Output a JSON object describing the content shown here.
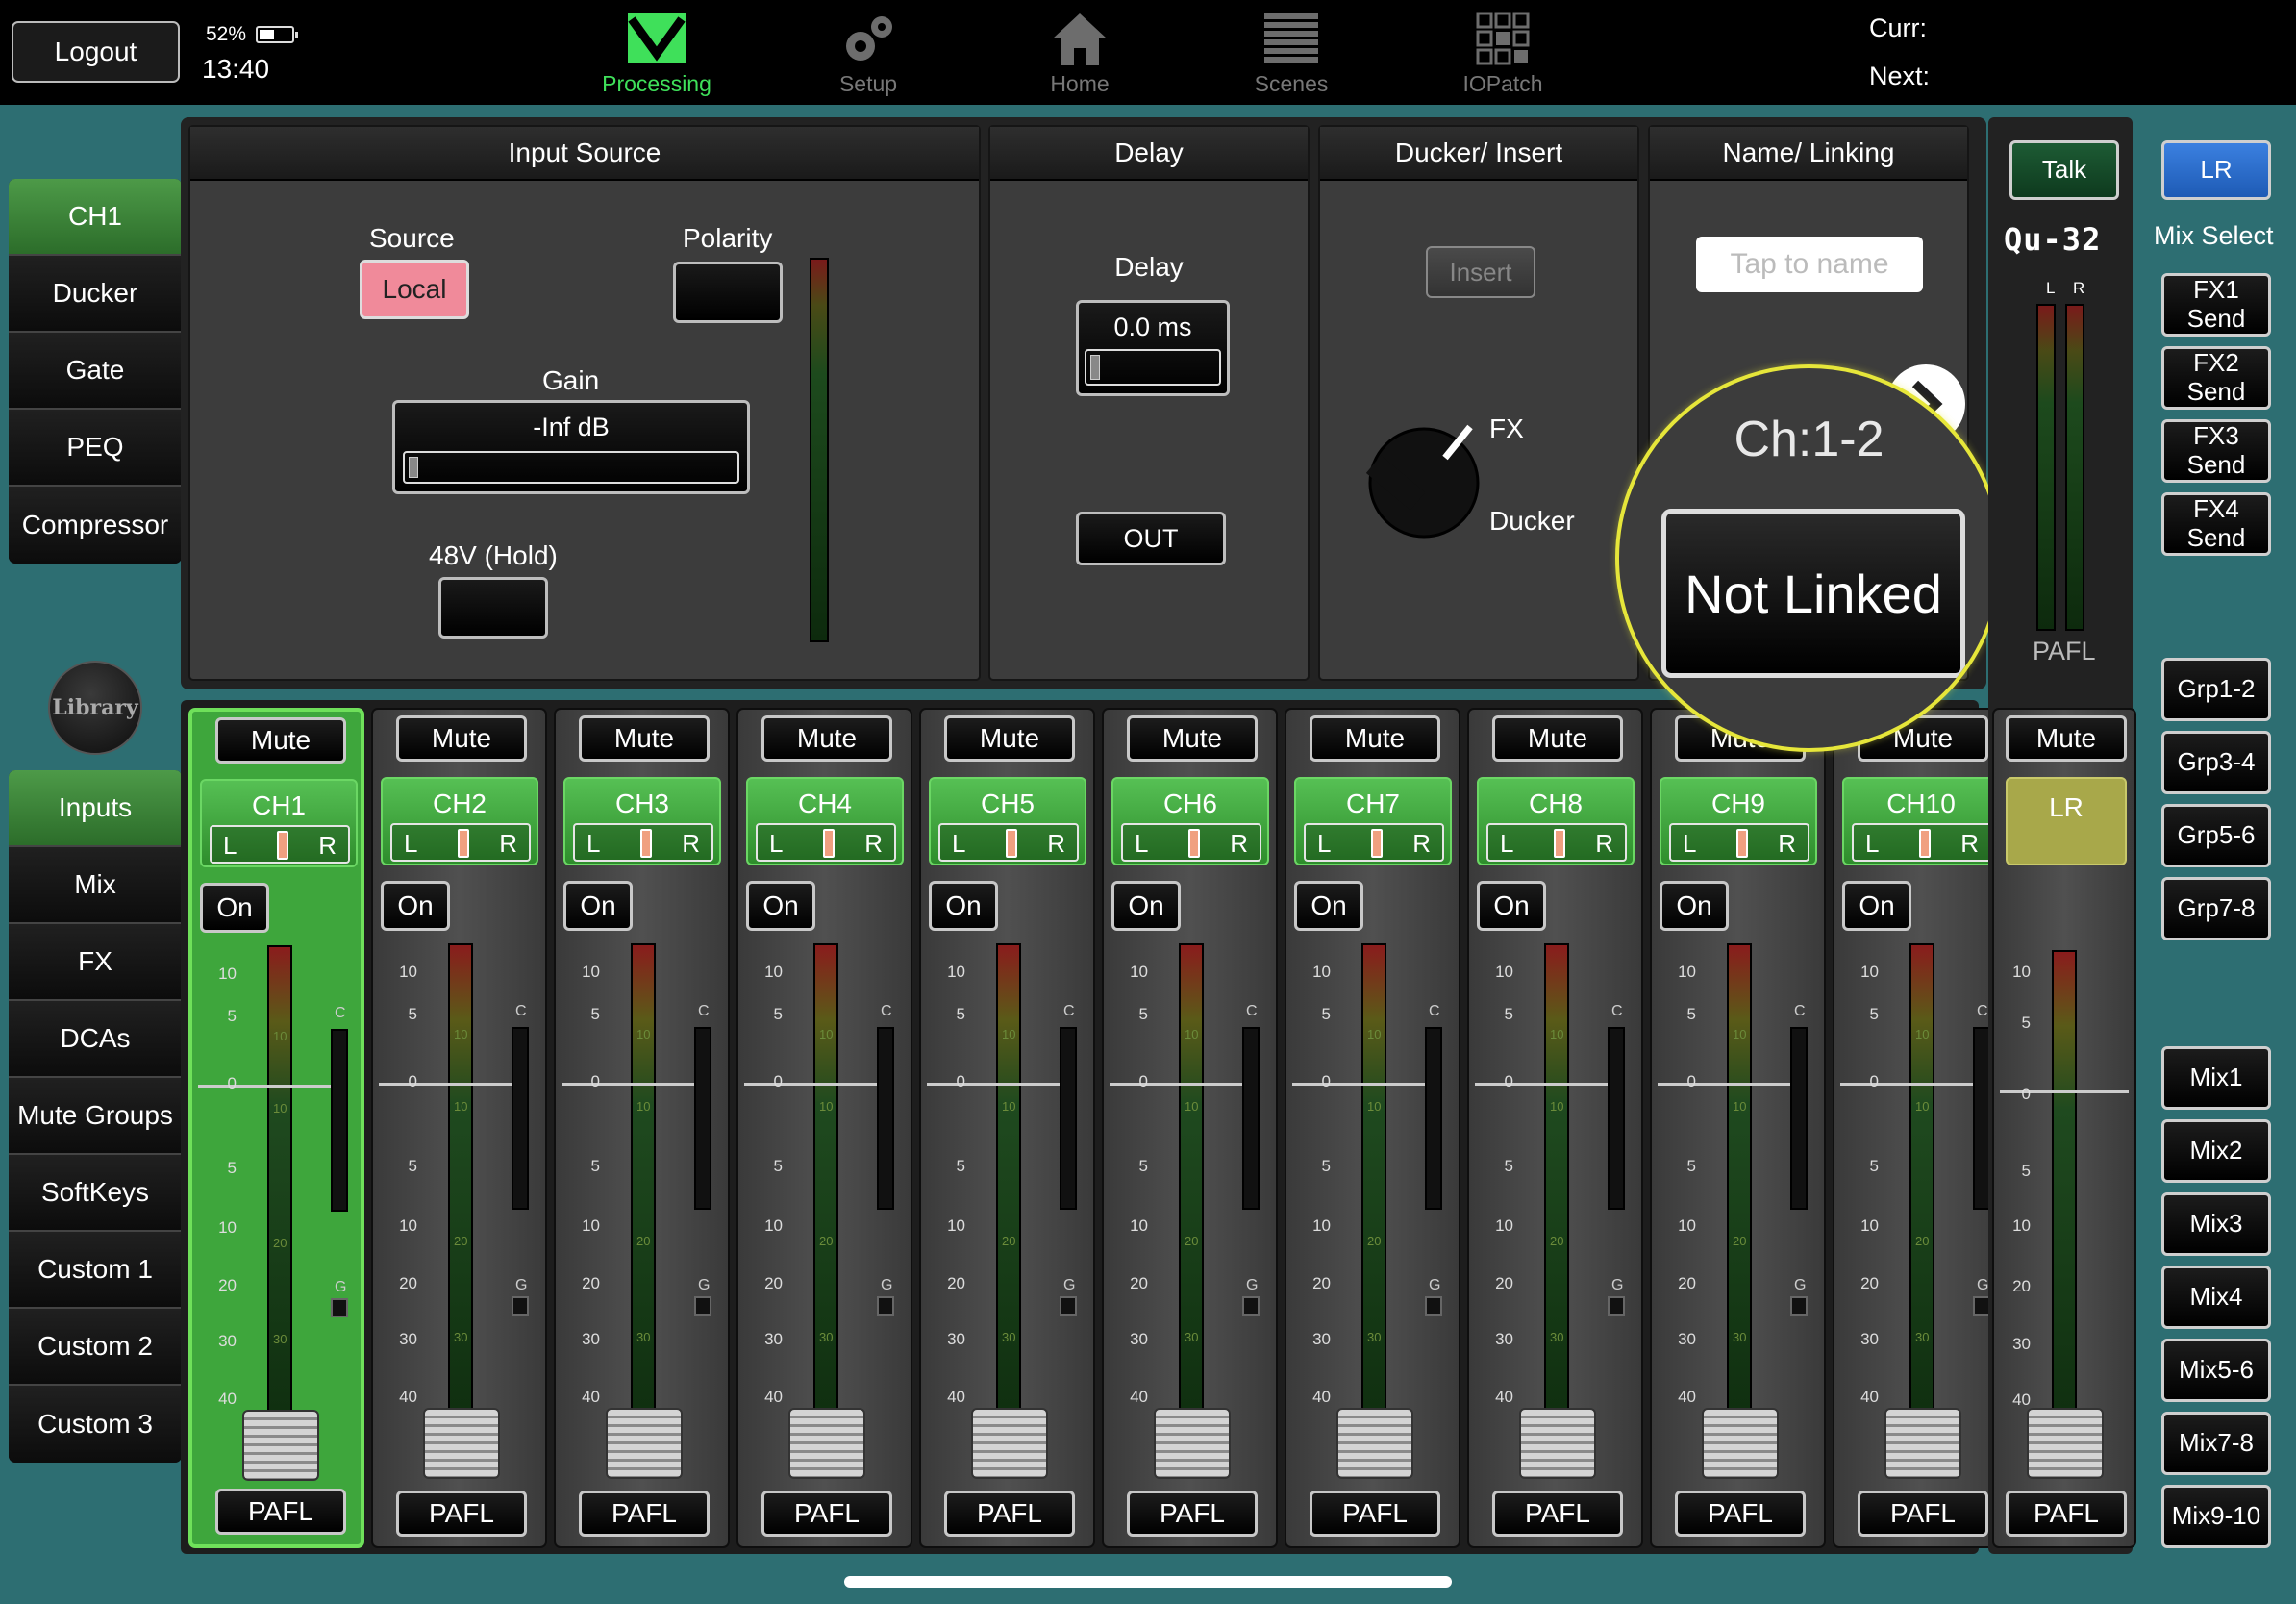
{
  "topbar": {
    "logout": "Logout",
    "battery": "52%",
    "time": "13:40",
    "nav": [
      {
        "label": "Processing",
        "icon": "processing-icon"
      },
      {
        "label": "Setup",
        "icon": "gear-icon"
      },
      {
        "label": "Home",
        "icon": "home-icon"
      },
      {
        "label": "Scenes",
        "icon": "scenes-icon"
      },
      {
        "label": "IOPatch",
        "icon": "iopatch-icon"
      }
    ],
    "curr": "Curr:",
    "next": "Next:"
  },
  "processing_tabs": [
    "CH1",
    "Ducker",
    "Gate",
    "PEQ",
    "Compressor"
  ],
  "library": "Library",
  "layer_tabs": [
    "Inputs",
    "Mix",
    "FX",
    "DCAs",
    "Mute Groups",
    "SoftKeys",
    "Custom 1",
    "Custom 2",
    "Custom 3"
  ],
  "input_source": {
    "title": "Input Source",
    "source_label": "Source",
    "source_value": "Local",
    "polarity_label": "Polarity",
    "gain_label": "Gain",
    "gain_value": "-Inf dB",
    "phantom_label": "48V (Hold)"
  },
  "delay": {
    "title": "Delay",
    "label": "Delay",
    "value": "0.0 ms",
    "out": "OUT"
  },
  "ducker_insert": {
    "title": "Ducker/ Insert",
    "insert": "Insert",
    "fx": "FX",
    "ducker": "Ducker"
  },
  "name_linking": {
    "title": "Name/ Linking",
    "placeholder": "Tap to name",
    "channels": "Ch:1-2",
    "link_state": "Not Linked"
  },
  "strip_common": {
    "mute": "Mute",
    "on": "On",
    "pafl": "PAFL",
    "pan_left": "L",
    "pan_right": "R",
    "comp_label": "C",
    "gate_label": "G",
    "meter_marks": [
      "10",
      "10",
      "20",
      "30"
    ],
    "scale": [
      "10",
      "5",
      "0",
      "5",
      "10",
      "20",
      "30",
      "40"
    ]
  },
  "channels": [
    "CH1",
    "CH2",
    "CH3",
    "CH4",
    "CH5",
    "CH6",
    "CH7",
    "CH8",
    "CH9",
    "CH10"
  ],
  "selected_channel": "CH1",
  "master": {
    "talk": "Talk",
    "lr_button": "LR",
    "model": "Qu-32",
    "meter_l": "L",
    "meter_r": "R",
    "pafl_label": "PAFL",
    "mix_select": "Mix Select",
    "mute": "Mute",
    "name": "LR",
    "pafl": "PAFL",
    "scale": [
      "10",
      "5",
      "0",
      "5",
      "10",
      "20",
      "30",
      "40"
    ]
  },
  "mix_buttons": [
    "FX1 Send",
    "FX2 Send",
    "FX3 Send",
    "FX4 Send",
    "Grp1-2",
    "Grp3-4",
    "Grp5-6",
    "Grp7-8",
    "Mix1",
    "Mix2",
    "Mix3",
    "Mix4",
    "Mix5-6",
    "Mix7-8",
    "Mix9-10"
  ],
  "colors": {
    "accent_green": "#3fe05a",
    "selected_strip": "#3ea63c",
    "source_pink": "#f08a9a",
    "lr_yellow": "#a8a84a",
    "magnifier": "#e6e63a",
    "mix_select_blue": "#2f6fd0"
  }
}
